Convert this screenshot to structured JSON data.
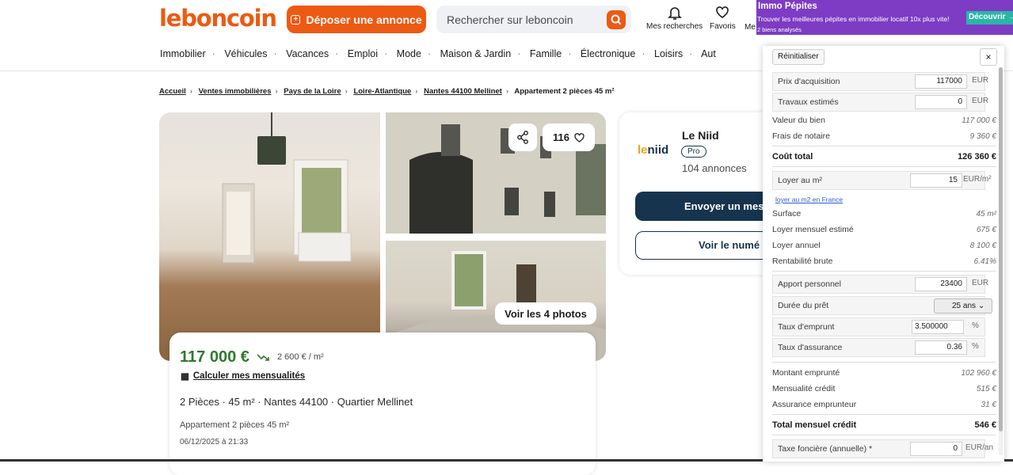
{
  "header": {
    "logo": "leboncoin",
    "post_ad": "Déposer une annonce",
    "search_placeholder": "Rechercher sur leboncoin",
    "my_searches": "Mes recherches",
    "favorites": "Favoris",
    "messages_partial": "Me"
  },
  "categories": [
    "Immobilier",
    "Véhicules",
    "Vacances",
    "Emploi",
    "Mode",
    "Maison & Jardin",
    "Famille",
    "Électronique",
    "Loisirs",
    "Aut"
  ],
  "breadcrumb": [
    "Accueil",
    "Ventes immobilières",
    "Pays de la Loire",
    "Loire-Atlantique",
    "Nantes 44100 Mellinet",
    "Appartement 2 pièces 45 m²"
  ],
  "gallery": {
    "favorites_count": "116",
    "see_photos": "Voir les 4 photos"
  },
  "listing": {
    "price": "117 000 €",
    "price_per_m2": "2 600 € / m²",
    "calc_link": "Calculer mes mensualités",
    "summary": "2 Pièces · 45 m² · Nantes 44100 · Quartier Mellinet",
    "title": "Appartement 2 pièces 45 m²",
    "date": "06/12/2025 à 21:33"
  },
  "agent": {
    "logo_a": "le",
    "logo_b": "niid",
    "name": "Le Niid",
    "badge": "Pro",
    "listings": "104 annonces",
    "send_message": "Envoyer un mes",
    "see_number": "Voir le numé"
  },
  "extension": {
    "title": "Immo Pépites",
    "subtitle": "Trouver les meilleures pépites en immobilier locatif 10x plus vite!",
    "count": "2 biens analysés",
    "discover": "Découvrir →",
    "reset": "Réinitialiser",
    "close": "×",
    "acquisition_label": "Prix d'acquisition",
    "acquisition_value": "117000",
    "works_label": "Travaux estimés",
    "works_value": "0",
    "eur": "EUR",
    "property_value_label": "Valeur du bien",
    "property_value": "117 000 €",
    "notary_label": "Frais de notaire",
    "notary_value": "9 360 €",
    "total_cost_label": "Coût total",
    "total_cost_value": "126 360 €",
    "rent_m2_label": "Loyer au m²",
    "rent_m2_value": "15",
    "rent_m2_unit": "EUR/m²",
    "rent_m2_link": "loyer au m2 en France",
    "surface_label": "Surface",
    "surface_value": "45 m²",
    "monthly_rent_label": "Loyer mensuel estimé",
    "monthly_rent_value": "675 €",
    "annual_rent_label": "Loyer annuel",
    "annual_rent_value": "8 100 €",
    "gross_yield_label": "Rentabilité brute",
    "gross_yield_value": "6.41%",
    "down_payment_label": "Apport personnel",
    "down_payment_value": "23400",
    "duration_label": "Durée du prêt",
    "duration_value": "25 ans",
    "rate_label": "Taux d'emprunt",
    "rate_value": "3.500000",
    "insurance_rate_label": "Taux d'assurance",
    "insurance_rate_value": "0.36",
    "pct": "%",
    "borrowed_label": "Montant emprunté",
    "borrowed_value": "102 960 €",
    "monthly_credit_label": "Mensualité crédit",
    "monthly_credit_value": "515 €",
    "borrower_ins_label": "Assurance emprunteur",
    "borrower_ins_value": "31 €",
    "total_monthly_label": "Total mensuel crédit",
    "total_monthly_value": "546 €",
    "property_tax_label": "Taxe foncière (annuelle) *",
    "property_tax_value": "0",
    "property_tax_unit": "EUR/an"
  },
  "colors": {
    "brand": "#ec5a13",
    "navy": "#16344d",
    "price_green": "#2d7a2d",
    "extension_purple": "#7d3cc3",
    "extension_teal": "#2ab5a8"
  }
}
